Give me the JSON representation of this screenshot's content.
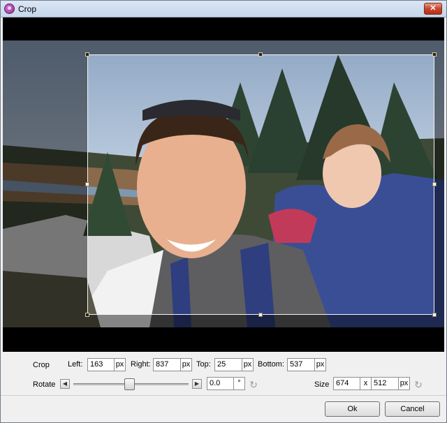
{
  "window": {
    "title": "Crop",
    "close_label": "✕"
  },
  "crop": {
    "section_label": "Crop",
    "left": {
      "label": "Left:",
      "value": "163",
      "unit": "px"
    },
    "right": {
      "label": "Right:",
      "value": "837",
      "unit": "px"
    },
    "top": {
      "label": "Top:",
      "value": "25",
      "unit": "px"
    },
    "bottom": {
      "label": "Bottom:",
      "value": "537",
      "unit": "px"
    }
  },
  "rotate": {
    "label": "Rotate",
    "value": "0.0",
    "unit": "°",
    "left_arrow": "◀",
    "right_arrow": "▶",
    "reset_icon": "↻"
  },
  "size": {
    "label": "Size",
    "width": "674",
    "separator": "x",
    "height": "512",
    "unit": "px",
    "reset_icon": "↻"
  },
  "buttons": {
    "ok": "Ok",
    "cancel": "Cancel"
  },
  "icons": {
    "app": "app-icon",
    "close": "close-icon",
    "rotate_reset": "rotate-reset-icon",
    "size_reset": "size-reset-icon"
  }
}
